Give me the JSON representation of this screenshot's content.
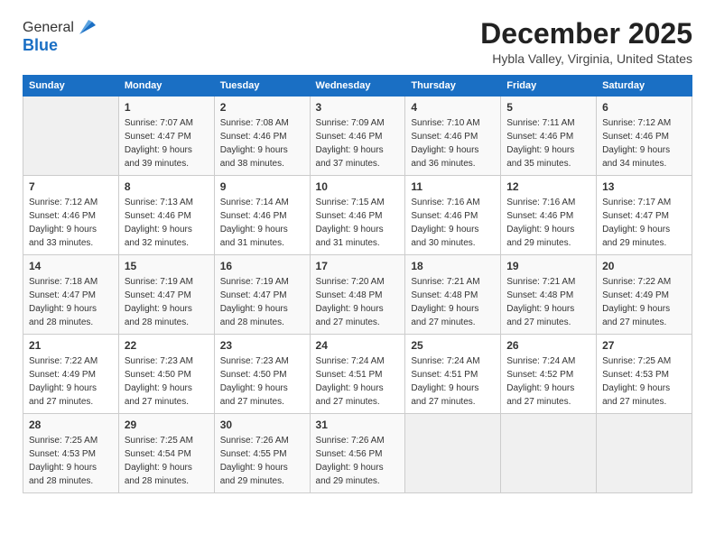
{
  "logo": {
    "general": "General",
    "blue": "Blue"
  },
  "title": "December 2025",
  "location": "Hybla Valley, Virginia, United States",
  "days_of_week": [
    "Sunday",
    "Monday",
    "Tuesday",
    "Wednesday",
    "Thursday",
    "Friday",
    "Saturday"
  ],
  "weeks": [
    [
      {
        "day": "",
        "sunrise": "",
        "sunset": "",
        "daylight": "",
        "empty": true
      },
      {
        "day": "1",
        "sunrise": "Sunrise: 7:07 AM",
        "sunset": "Sunset: 4:47 PM",
        "daylight": "Daylight: 9 hours and 39 minutes."
      },
      {
        "day": "2",
        "sunrise": "Sunrise: 7:08 AM",
        "sunset": "Sunset: 4:46 PM",
        "daylight": "Daylight: 9 hours and 38 minutes."
      },
      {
        "day": "3",
        "sunrise": "Sunrise: 7:09 AM",
        "sunset": "Sunset: 4:46 PM",
        "daylight": "Daylight: 9 hours and 37 minutes."
      },
      {
        "day": "4",
        "sunrise": "Sunrise: 7:10 AM",
        "sunset": "Sunset: 4:46 PM",
        "daylight": "Daylight: 9 hours and 36 minutes."
      },
      {
        "day": "5",
        "sunrise": "Sunrise: 7:11 AM",
        "sunset": "Sunset: 4:46 PM",
        "daylight": "Daylight: 9 hours and 35 minutes."
      },
      {
        "day": "6",
        "sunrise": "Sunrise: 7:12 AM",
        "sunset": "Sunset: 4:46 PM",
        "daylight": "Daylight: 9 hours and 34 minutes."
      }
    ],
    [
      {
        "day": "7",
        "sunrise": "Sunrise: 7:12 AM",
        "sunset": "Sunset: 4:46 PM",
        "daylight": "Daylight: 9 hours and 33 minutes."
      },
      {
        "day": "8",
        "sunrise": "Sunrise: 7:13 AM",
        "sunset": "Sunset: 4:46 PM",
        "daylight": "Daylight: 9 hours and 32 minutes."
      },
      {
        "day": "9",
        "sunrise": "Sunrise: 7:14 AM",
        "sunset": "Sunset: 4:46 PM",
        "daylight": "Daylight: 9 hours and 31 minutes."
      },
      {
        "day": "10",
        "sunrise": "Sunrise: 7:15 AM",
        "sunset": "Sunset: 4:46 PM",
        "daylight": "Daylight: 9 hours and 31 minutes."
      },
      {
        "day": "11",
        "sunrise": "Sunrise: 7:16 AM",
        "sunset": "Sunset: 4:46 PM",
        "daylight": "Daylight: 9 hours and 30 minutes."
      },
      {
        "day": "12",
        "sunrise": "Sunrise: 7:16 AM",
        "sunset": "Sunset: 4:46 PM",
        "daylight": "Daylight: 9 hours and 29 minutes."
      },
      {
        "day": "13",
        "sunrise": "Sunrise: 7:17 AM",
        "sunset": "Sunset: 4:47 PM",
        "daylight": "Daylight: 9 hours and 29 minutes."
      }
    ],
    [
      {
        "day": "14",
        "sunrise": "Sunrise: 7:18 AM",
        "sunset": "Sunset: 4:47 PM",
        "daylight": "Daylight: 9 hours and 28 minutes."
      },
      {
        "day": "15",
        "sunrise": "Sunrise: 7:19 AM",
        "sunset": "Sunset: 4:47 PM",
        "daylight": "Daylight: 9 hours and 28 minutes."
      },
      {
        "day": "16",
        "sunrise": "Sunrise: 7:19 AM",
        "sunset": "Sunset: 4:47 PM",
        "daylight": "Daylight: 9 hours and 28 minutes."
      },
      {
        "day": "17",
        "sunrise": "Sunrise: 7:20 AM",
        "sunset": "Sunset: 4:48 PM",
        "daylight": "Daylight: 9 hours and 27 minutes."
      },
      {
        "day": "18",
        "sunrise": "Sunrise: 7:21 AM",
        "sunset": "Sunset: 4:48 PM",
        "daylight": "Daylight: 9 hours and 27 minutes."
      },
      {
        "day": "19",
        "sunrise": "Sunrise: 7:21 AM",
        "sunset": "Sunset: 4:48 PM",
        "daylight": "Daylight: 9 hours and 27 minutes."
      },
      {
        "day": "20",
        "sunrise": "Sunrise: 7:22 AM",
        "sunset": "Sunset: 4:49 PM",
        "daylight": "Daylight: 9 hours and 27 minutes."
      }
    ],
    [
      {
        "day": "21",
        "sunrise": "Sunrise: 7:22 AM",
        "sunset": "Sunset: 4:49 PM",
        "daylight": "Daylight: 9 hours and 27 minutes."
      },
      {
        "day": "22",
        "sunrise": "Sunrise: 7:23 AM",
        "sunset": "Sunset: 4:50 PM",
        "daylight": "Daylight: 9 hours and 27 minutes."
      },
      {
        "day": "23",
        "sunrise": "Sunrise: 7:23 AM",
        "sunset": "Sunset: 4:50 PM",
        "daylight": "Daylight: 9 hours and 27 minutes."
      },
      {
        "day": "24",
        "sunrise": "Sunrise: 7:24 AM",
        "sunset": "Sunset: 4:51 PM",
        "daylight": "Daylight: 9 hours and 27 minutes."
      },
      {
        "day": "25",
        "sunrise": "Sunrise: 7:24 AM",
        "sunset": "Sunset: 4:51 PM",
        "daylight": "Daylight: 9 hours and 27 minutes."
      },
      {
        "day": "26",
        "sunrise": "Sunrise: 7:24 AM",
        "sunset": "Sunset: 4:52 PM",
        "daylight": "Daylight: 9 hours and 27 minutes."
      },
      {
        "day": "27",
        "sunrise": "Sunrise: 7:25 AM",
        "sunset": "Sunset: 4:53 PM",
        "daylight": "Daylight: 9 hours and 27 minutes."
      }
    ],
    [
      {
        "day": "28",
        "sunrise": "Sunrise: 7:25 AM",
        "sunset": "Sunset: 4:53 PM",
        "daylight": "Daylight: 9 hours and 28 minutes."
      },
      {
        "day": "29",
        "sunrise": "Sunrise: 7:25 AM",
        "sunset": "Sunset: 4:54 PM",
        "daylight": "Daylight: 9 hours and 28 minutes."
      },
      {
        "day": "30",
        "sunrise": "Sunrise: 7:26 AM",
        "sunset": "Sunset: 4:55 PM",
        "daylight": "Daylight: 9 hours and 29 minutes."
      },
      {
        "day": "31",
        "sunrise": "Sunrise: 7:26 AM",
        "sunset": "Sunset: 4:56 PM",
        "daylight": "Daylight: 9 hours and 29 minutes."
      },
      {
        "day": "",
        "sunrise": "",
        "sunset": "",
        "daylight": "",
        "empty": true
      },
      {
        "day": "",
        "sunrise": "",
        "sunset": "",
        "daylight": "",
        "empty": true
      },
      {
        "day": "",
        "sunrise": "",
        "sunset": "",
        "daylight": "",
        "empty": true
      }
    ]
  ],
  "accent_color": "#1a6fc4"
}
